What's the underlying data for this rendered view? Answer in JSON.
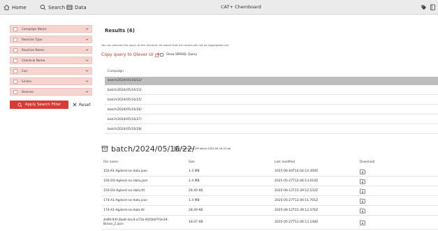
{
  "topbar": {
    "home_label": "Home",
    "search_label": "Search",
    "data_label": "Data",
    "title": "CAT+ Chemboard",
    "icons": [
      "home-icon",
      "search-icon",
      "data-icon",
      "tag-icon",
      "book-icon"
    ]
  },
  "sidebar": {
    "filters": [
      {
        "label": "Campaign Name:"
      },
      {
        "label": "Reaction Type:"
      },
      {
        "label": "Reaction Name:"
      },
      {
        "label": "Chemical Name:"
      },
      {
        "label": "Cas:"
      },
      {
        "label": "Smiles:"
      },
      {
        "label": "Devices:"
      }
    ],
    "apply_label": "Apply Search Filter",
    "reset_label": "Reset"
  },
  "results": {
    "title": "Results (6)",
    "note": "You can execute the query at the QleverUI: be aware that the results will not be aggregated yet:",
    "copy_link_label": "Copy query to Qlever UI",
    "sparql_label": "Show SPARQL Query",
    "campaign_header": "Campaign",
    "campaigns": [
      "batch/2024/05/16/22/",
      "batch/2024/05/16/23/",
      "batch/2024/05/16/25/",
      "batch/2024/05/16/26/",
      "batch/2024/05/16/27/",
      "batch/2024/05/16/28/"
    ],
    "selected_index": 0
  },
  "detail": {
    "title": "batch/2024/05/16/22/",
    "download_zip_label": "Download ZIP batch-2024-05-16-22.zip",
    "columns": {
      "name": "File name",
      "size": "Size",
      "modified": "Last modified",
      "download": "Download"
    },
    "files": [
      {
        "name": "150-A1-Agilent-no-data.json",
        "size": "1.4 MB",
        "modified": "2025-06-04T14:04:14.309Z"
      },
      {
        "name": "150-D3-Agilent-no-data.json",
        "size": "1.4 MB",
        "modified": "2025-05-27T12:46:13.010Z"
      },
      {
        "name": "150-D3-Agilent-no-data.ttl",
        "size": "28.49 KB",
        "modified": "2025-06-12T15:39:12.532Z"
      },
      {
        "name": "174-A1-Agilent-no-data.json",
        "size": "1.4 MB",
        "modified": "2025-05-27T12:46:11.701Z"
      },
      {
        "name": "174-A1-Agilent-no-data.ttl",
        "size": "28.49 KB",
        "modified": "2025-06-12T15:39:12.376Z"
      },
      {
        "name": "4d9fc93f-2ba6-4ec4-a71b-92f2b97f3e19-Bravo_2.json",
        "size": "18.07 KB",
        "modified": "2025-05-27T12:46:13.148Z"
      }
    ]
  },
  "colors": {
    "accent": "#d83b33",
    "filter_bg": "#f6d5d1",
    "selected_row": "#bdbdbd",
    "topbar_bg": "#ebebeb"
  }
}
